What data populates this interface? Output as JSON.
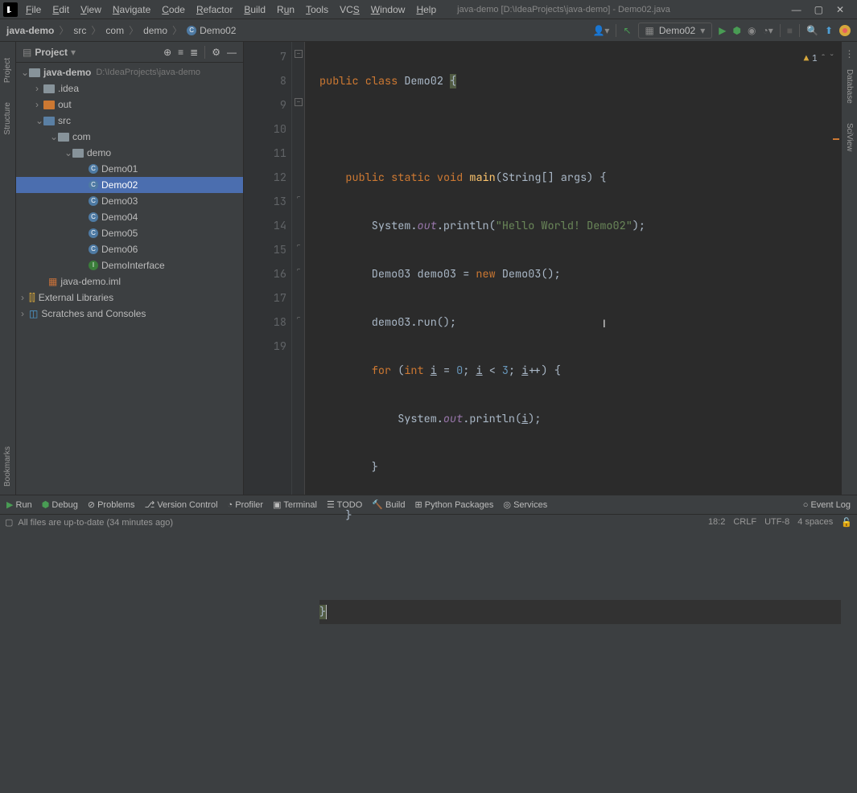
{
  "window": {
    "title": "java-demo [D:\\IdeaProjects\\java-demo] - Demo02.java"
  },
  "menu": [
    "File",
    "Edit",
    "View",
    "Navigate",
    "Code",
    "Refactor",
    "Build",
    "Run",
    "Tools",
    "VCS",
    "Window",
    "Help"
  ],
  "breadcrumb": {
    "project": "java-demo",
    "p1": "src",
    "p2": "com",
    "p3": "demo",
    "cls": "Demo02"
  },
  "runconfig": "Demo02",
  "project_panel": {
    "title": "Project",
    "root": "java-demo",
    "root_path": "D:\\IdeaProjects\\java-demo",
    "idea": ".idea",
    "out": "out",
    "src": "src",
    "com": "com",
    "demo": "demo",
    "files": [
      "Demo01",
      "Demo02",
      "Demo03",
      "Demo04",
      "Demo05",
      "Demo06",
      "DemoInterface"
    ],
    "iml": "java-demo.iml",
    "ext": "External Libraries",
    "scratch": "Scratches and Consoles"
  },
  "editor": {
    "lines": [
      "7",
      "8",
      "9",
      "10",
      "11",
      "12",
      "13",
      "14",
      "15",
      "16",
      "17",
      "18",
      "19"
    ],
    "warn_count": "1"
  },
  "bottom": {
    "run": "Run",
    "debug": "Debug",
    "problems": "Problems",
    "vcs": "Version Control",
    "profiler": "Profiler",
    "terminal": "Terminal",
    "todo": "TODO",
    "build": "Build",
    "python": "Python Packages",
    "services": "Services",
    "eventlog": "Event Log"
  },
  "status": {
    "msg": "All files are up-to-date (34 minutes ago)",
    "pos": "18:2",
    "le": "CRLF",
    "enc": "UTF-8",
    "indent": "4 spaces"
  }
}
